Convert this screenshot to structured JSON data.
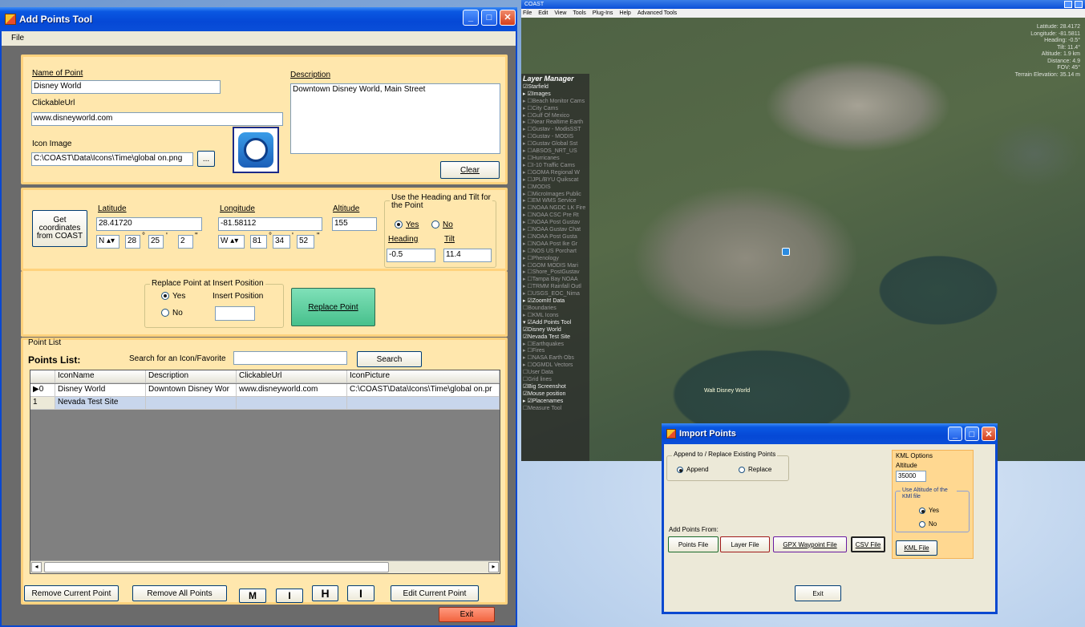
{
  "main_window": {
    "title": "Add Points Tool",
    "menu": [
      "File"
    ]
  },
  "point_info": {
    "name_label": "Name of Point",
    "name_value": "Disney World",
    "url_label": "ClickableUrl",
    "url_value": "www.disneyworld.com",
    "icon_label": "Icon Image",
    "icon_path": "C:\\COAST\\Data\\Icons\\Time\\global on.png",
    "browse_label": "...",
    "description_label": "Description",
    "description_value": "Downtown Disney World, Main Street",
    "clear_label": "Clear"
  },
  "coords": {
    "get_btn": "Get coordinates from COAST",
    "lat_label": "Latitude",
    "lat_value": "28.41720",
    "lat_dir": "N",
    "lat_deg": "28",
    "lat_min": "25",
    "lat_sec": "2",
    "lon_label": "Longitude",
    "lon_value": "-81.58112",
    "lon_dir": "W",
    "lon_deg": "81",
    "lon_min": "34",
    "lon_sec": "52",
    "alt_label": "Altitude",
    "alt_value": "155",
    "deg_sym": "°",
    "min_sym": "'",
    "sec_sym": "\"",
    "heading_group": "Use the Heading and Tilt for the Point",
    "yes": "Yes",
    "no": "No",
    "heading_label": "Heading",
    "heading_value": "-0.5",
    "tilt_label": "Tilt",
    "tilt_value": "11.4"
  },
  "replace": {
    "group": "Replace Point at Insert Position",
    "yes": "Yes",
    "no": "No",
    "insert_label": "Insert Position",
    "insert_value": "",
    "button": "Replace Point"
  },
  "point_list": {
    "group": "Point List",
    "title": "Points List:",
    "search_label": "Search for an Icon/Favorite",
    "search_value": "",
    "search_btn": "Search",
    "columns": [
      "",
      "IconName",
      "Description",
      "ClickableUrl",
      "IconPicture"
    ],
    "rows": [
      [
        "▶0",
        "Disney World",
        "Downtown Disney Wor",
        "www.disneyworld.com",
        "C:\\COAST\\Data\\Icons\\Time\\global on.pr"
      ],
      [
        "1",
        "Nevada Test Site",
        "",
        "",
        ""
      ]
    ],
    "remove_current": "Remove Current Point",
    "remove_all": "Remove All Points",
    "m": "M",
    "i": "I",
    "h": "H",
    "i2": "I",
    "edit_current": "Edit Current Point"
  },
  "exit_label": "Exit",
  "coast": {
    "title": "COAST",
    "menu": [
      "File",
      "Edit",
      "View",
      "Tools",
      "Plug-Ins",
      "Help",
      "Advanced Tools"
    ],
    "layer_manager_title": "Layer Manager",
    "layers": [
      [
        "☑Starfield",
        ""
      ],
      [
        "▸ ☑Images",
        ""
      ],
      [
        "▸ ☐Beach Monitor Cams",
        "dim"
      ],
      [
        "▸ ☐City Cams",
        "dim"
      ],
      [
        "▸ ☐Gulf Of Mexico",
        "dim"
      ],
      [
        "▸ ☐Near Realtime Earth",
        "dim"
      ],
      [
        "▸ ☐Gustav - ModisSST",
        "dim"
      ],
      [
        "▸ ☐Gustav - MODIS",
        "dim"
      ],
      [
        "▸ ☐Gustav Global Sst",
        "dim"
      ],
      [
        "▸ ☐ABSOS_NRT_US",
        "dim"
      ],
      [
        "▸ ☐Hurricanes",
        "dim"
      ],
      [
        "▸ ☐I-10 Traffic Cams",
        "dim"
      ],
      [
        "▸ ☐GOMA Regional W",
        "dim"
      ],
      [
        "▸ ☐JPL/BYU Quikscat",
        "dim"
      ],
      [
        "▸ ☐MODIS",
        "dim"
      ],
      [
        "▸ ☐MicroImages Public",
        "dim"
      ],
      [
        "▸ ☐EM WMS Service",
        "dim"
      ],
      [
        "▸ ☐NOAA NGDC LK Fire",
        "dim"
      ],
      [
        "▸ ☐NOAA CSC Pre Rt",
        "dim"
      ],
      [
        "▸ ☐NOAA Post Gustav",
        "dim"
      ],
      [
        "▸ ☐NOAA Gustav Chat",
        "dim"
      ],
      [
        "▸ ☐NOAA Post Gusta",
        "dim"
      ],
      [
        "▸ ☐NOAA Post Ike Gr",
        "dim"
      ],
      [
        "▸ ☐NOS US Porchart",
        "dim"
      ],
      [
        "▸ ☐Phenology",
        "dim"
      ],
      [
        "▸ ☐GOM MODIS Mari",
        "dim"
      ],
      [
        "▸ ☐Shore_PostGustav",
        "dim"
      ],
      [
        "▸ ☐Tampa Bay NOAA",
        "dim"
      ],
      [
        "▸ ☐TRMM Rainfall Outl",
        "dim"
      ],
      [
        "▸ ☐USGS_EOC_Nima",
        "dim"
      ],
      [
        "▸ ☑ZoomIt! Data",
        ""
      ],
      [
        "☐Boundaries",
        "dim"
      ],
      [
        "▸ ☐KML Icons",
        "dim"
      ],
      [
        "▾ ☑Add Points Tool",
        ""
      ],
      [
        "  ☑Disney World",
        ""
      ],
      [
        "  ☑Nevada Test Site",
        ""
      ],
      [
        "▸ ☐Earthquakes",
        "dim"
      ],
      [
        "▸ ☐Fires",
        "dim"
      ],
      [
        "▸ ☐NASA Earth Obs",
        "dim"
      ],
      [
        "▸ ☐OGMDL Vectors",
        "dim"
      ],
      [
        "☐User Data",
        "dim"
      ],
      [
        "☐Grid lines",
        "dim"
      ],
      [
        "☑Big Screenshot",
        ""
      ],
      [
        "☑Mouse position",
        ""
      ],
      [
        "▸ ☑Placenames",
        ""
      ],
      [
        "☐Measure Tool",
        "dim"
      ]
    ],
    "hud": [
      "Latitude: 28.4172",
      "Longitude: -81.5811",
      "Heading: -0.5°",
      "Tilt: 11.4°",
      "Altitude: 1.9 km",
      "Distance: 4.9",
      "FOV: 45°",
      "Terrain Elevation: 35.14 m"
    ],
    "map_label": "Walt Disney World"
  },
  "import": {
    "title": "Import Points",
    "append_group": "Append to / Replace Existing Points",
    "append": "Append",
    "replace": "Replace",
    "kml_group": "KML Options",
    "altitude_label": "Altitude",
    "altitude_value": "35000",
    "use_alt_group": "Use Altitude of the KMl file",
    "yes": "Yes",
    "no": "No",
    "add_from": "Add Points From:",
    "points_file": "Points File",
    "layer_file": "Layer File",
    "gpx_file": "GPX Waypoint File",
    "csv_file": "CSV File",
    "kml_file": "KML File",
    "exit": "Exit"
  }
}
